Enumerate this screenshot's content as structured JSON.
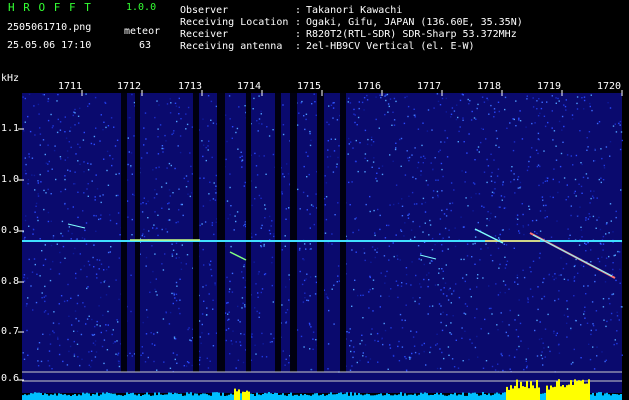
{
  "header": {
    "app_title": "H R O F F T",
    "version": "1.0.0",
    "filename": "2505061710.png",
    "meteor_label": "meteor",
    "datetime": "25.05.06 17:10",
    "meteor_count": "63",
    "info": [
      {
        "label": "Observer",
        "value": "Takanori Kawachi"
      },
      {
        "label": "Receiving Location",
        "value": "Ogaki, Gifu, JAPAN (136.60E, 35.35N)"
      },
      {
        "label": "Receiver",
        "value": "R820T2(RTL-SDR) SDR-Sharp 53.372MHz"
      },
      {
        "label": "Receiving antenna",
        "value": "2el-HB9CV Vertical (el. E-W)"
      }
    ]
  },
  "axes": {
    "y_unit": "kHz",
    "y_ticks": [
      "1.1",
      "1.0",
      "0.9",
      "0.8",
      "0.7",
      "0.6"
    ],
    "x_ticks": [
      "1711",
      "1712",
      "1713",
      "1714",
      "1715",
      "1716",
      "1717",
      "1718",
      "1719",
      "1720"
    ]
  },
  "colors": {
    "green_text": "#33ff33",
    "background": "#000000",
    "noise_bg": "#0a0a6e",
    "signal_line": "#40e0ff",
    "power_bars": "#00bfff",
    "peak_bars": "#ffff00"
  }
}
